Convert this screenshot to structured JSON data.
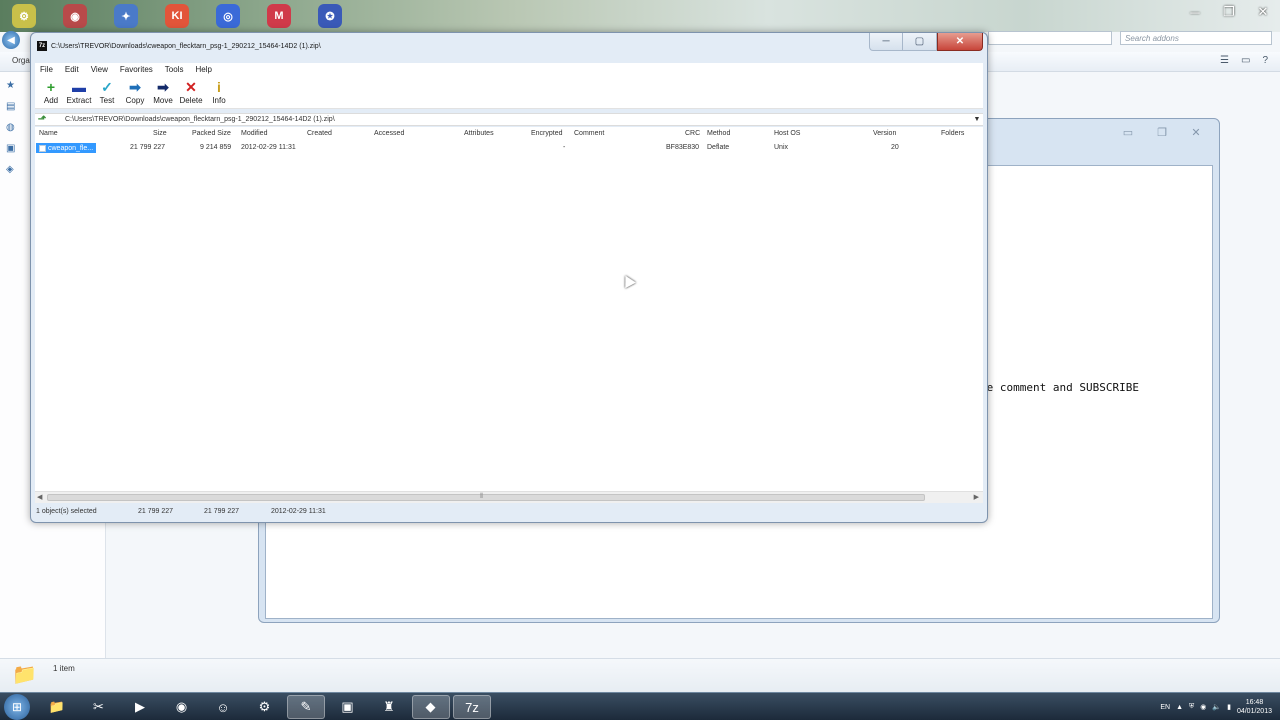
{
  "desktop": {
    "top_icons": [
      "⚙",
      "◉",
      "✦",
      "KI",
      "◎",
      "M",
      "✪"
    ]
  },
  "explorer": {
    "organize_label": "Orga",
    "search_placeholder": "Search addons",
    "status_item_count": "1 item"
  },
  "bg_window": {
    "visible_text": "te comment and SUBSCRIBE"
  },
  "sevenzip": {
    "title": "C:\\Users\\TREVOR\\Downloads\\cweapon_flecktarn_psg-1_290212_15464-14D2 (1).zip\\",
    "app_icon": "7z",
    "menu": [
      "File",
      "Edit",
      "View",
      "Favorites",
      "Tools",
      "Help"
    ],
    "toolbar": [
      {
        "label": "Add",
        "icon": "+",
        "color": "#2e9d2e"
      },
      {
        "label": "Extract",
        "icon": "▬",
        "color": "#1f3fa8"
      },
      {
        "label": "Test",
        "icon": "✓",
        "color": "#2aa6c8"
      },
      {
        "label": "Copy",
        "icon": "➡",
        "color": "#1f6fb8"
      },
      {
        "label": "Move",
        "icon": "➡",
        "color": "#142b6a"
      },
      {
        "label": "Delete",
        "icon": "✕",
        "color": "#d12020"
      },
      {
        "label": "Info",
        "icon": "i",
        "color": "#c9a020"
      }
    ],
    "path": "C:\\Users\\TREVOR\\Downloads\\cweapon_flecktarn_psg-1_290212_15464-14D2 (1).zip\\",
    "columns": [
      "Name",
      "Size",
      "Packed Size",
      "Modified",
      "Created",
      "Accessed",
      "Attributes",
      "Encrypted",
      "Comment",
      "CRC",
      "Method",
      "Host OS",
      "Version",
      "Folders"
    ],
    "rows": [
      {
        "name": "cweapon_fle...",
        "size": "21 799 227",
        "packed": "9 214 859",
        "modified": "2012-02-29 11:31",
        "encrypted": "-",
        "crc": "BF83E830",
        "method": "Deflate",
        "host": "Unix",
        "version": "20"
      }
    ],
    "status": {
      "selected": "1 object(s) selected",
      "size": "21 799 227",
      "packed": "21 799 227",
      "modified": "2012-02-29 11:31"
    }
  },
  "taskbar": {
    "apps": [
      {
        "name": "explorer",
        "icon": "📁"
      },
      {
        "name": "tools",
        "icon": "✂"
      },
      {
        "name": "media",
        "icon": "▶"
      },
      {
        "name": "chrome",
        "icon": "◉"
      },
      {
        "name": "messenger",
        "icon": "☺"
      },
      {
        "name": "network",
        "icon": "⚙"
      },
      {
        "name": "editor",
        "icon": "✎"
      },
      {
        "name": "files",
        "icon": "▣"
      },
      {
        "name": "game",
        "icon": "♜"
      },
      {
        "name": "ps",
        "icon": "◆"
      },
      {
        "name": "7zip",
        "icon": "7z"
      }
    ],
    "lang": "EN",
    "time": "16:48",
    "date": "04/01/2013"
  }
}
